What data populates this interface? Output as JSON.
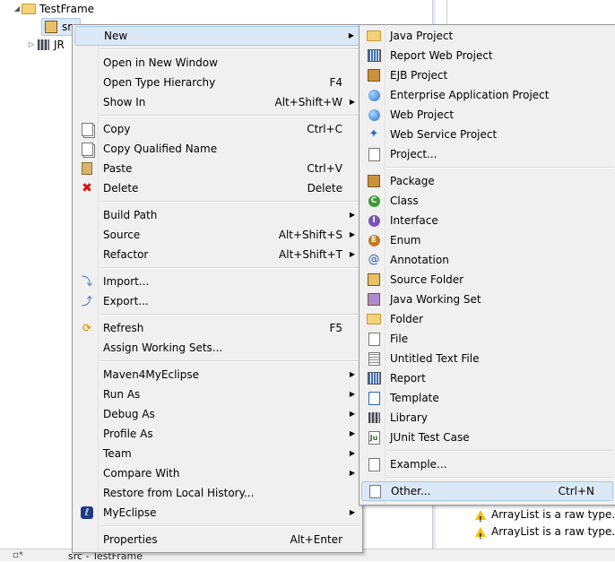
{
  "tree": {
    "project": "TestFrame",
    "src": "src",
    "jre": "JR"
  },
  "problems": [
    "ArrayList is a raw type. I",
    "ArrayList is a raw type. I"
  ],
  "statusbar": {
    "text": "src - TestFrame"
  },
  "context_menu": {
    "groups": [
      [
        {
          "label": "New",
          "shortcut": "",
          "submenu": true,
          "icon": "none",
          "highlight": true
        }
      ],
      [
        {
          "label": "Open in New Window",
          "shortcut": ""
        },
        {
          "label": "Open Type Hierarchy",
          "shortcut": "F4"
        },
        {
          "label": "Show In",
          "shortcut": "Alt+Shift+W",
          "submenu": true
        }
      ],
      [
        {
          "label": "Copy",
          "shortcut": "Ctrl+C",
          "icon": "copy-icon"
        },
        {
          "label": "Copy Qualified Name",
          "shortcut": "",
          "icon": "copy-qualified-icon"
        },
        {
          "label": "Paste",
          "shortcut": "Ctrl+V",
          "icon": "paste-icon"
        },
        {
          "label": "Delete",
          "shortcut": "Delete",
          "icon": "delete-icon"
        }
      ],
      [
        {
          "label": "Build Path",
          "shortcut": "",
          "submenu": true
        },
        {
          "label": "Source",
          "shortcut": "Alt+Shift+S",
          "submenu": true
        },
        {
          "label": "Refactor",
          "shortcut": "Alt+Shift+T",
          "submenu": true
        }
      ],
      [
        {
          "label": "Import...",
          "shortcut": "",
          "icon": "import-icon"
        },
        {
          "label": "Export...",
          "shortcut": "",
          "icon": "export-icon"
        }
      ],
      [
        {
          "label": "Refresh",
          "shortcut": "F5",
          "icon": "refresh-icon"
        },
        {
          "label": "Assign Working Sets...",
          "shortcut": ""
        }
      ],
      [
        {
          "label": "Maven4MyEclipse",
          "shortcut": "",
          "submenu": true
        },
        {
          "label": "Run As",
          "shortcut": "",
          "submenu": true
        },
        {
          "label": "Debug As",
          "shortcut": "",
          "submenu": true
        },
        {
          "label": "Profile As",
          "shortcut": "",
          "submenu": true
        },
        {
          "label": "Team",
          "shortcut": "",
          "submenu": true
        },
        {
          "label": "Compare With",
          "shortcut": "",
          "submenu": true
        },
        {
          "label": "Restore from Local History...",
          "shortcut": ""
        },
        {
          "label": "MyEclipse",
          "shortcut": "",
          "submenu": true,
          "icon": "myeclipse-icon"
        }
      ],
      [
        {
          "label": "Properties",
          "shortcut": "Alt+Enter"
        }
      ]
    ]
  },
  "new_submenu": {
    "groups": [
      [
        {
          "label": "Java Project",
          "icon": "java-project-icon"
        },
        {
          "label": "Report Web Project",
          "icon": "report-web-project-icon"
        },
        {
          "label": "EJB Project",
          "icon": "ejb-project-icon"
        },
        {
          "label": "Enterprise Application Project",
          "icon": "enterprise-project-icon"
        },
        {
          "label": "Web Project",
          "icon": "web-project-icon"
        },
        {
          "label": "Web Service Project",
          "icon": "web-service-project-icon"
        },
        {
          "label": "Project...",
          "icon": "project-wizard-icon"
        }
      ],
      [
        {
          "label": "Package",
          "icon": "package-icon"
        },
        {
          "label": "Class",
          "icon": "class-icon"
        },
        {
          "label": "Interface",
          "icon": "interface-icon"
        },
        {
          "label": "Enum",
          "icon": "enum-icon"
        },
        {
          "label": "Annotation",
          "icon": "annotation-icon"
        },
        {
          "label": "Source Folder",
          "icon": "source-folder-icon"
        },
        {
          "label": "Java Working Set",
          "icon": "working-set-icon"
        },
        {
          "label": "Folder",
          "icon": "folder-icon"
        },
        {
          "label": "File",
          "icon": "file-icon"
        },
        {
          "label": "Untitled Text File",
          "icon": "text-file-icon"
        },
        {
          "label": "Report",
          "icon": "report-icon"
        },
        {
          "label": "Template",
          "icon": "template-icon"
        },
        {
          "label": "Library",
          "icon": "library-icon"
        },
        {
          "label": "JUnit Test Case",
          "icon": "junit-icon"
        }
      ],
      [
        {
          "label": "Example...",
          "icon": "example-icon"
        }
      ],
      [
        {
          "label": "Other...",
          "shortcut": "Ctrl+N",
          "icon": "other-wizard-icon",
          "highlight": true
        }
      ]
    ]
  }
}
